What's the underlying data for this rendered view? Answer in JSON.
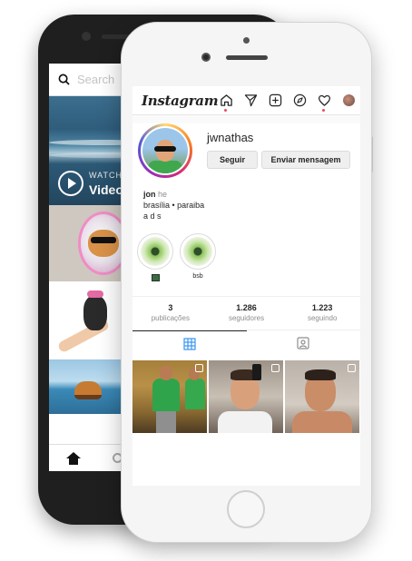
{
  "back_phone": {
    "search_placeholder": "Search",
    "video_tile": {
      "watch_label": "WATCH",
      "video_label": "Video"
    }
  },
  "front_phone": {
    "header": {
      "logo": "Instagram",
      "icons": [
        "home-icon",
        "direct-send-icon",
        "new-post-icon",
        "explore-compass-icon",
        "activity-heart-icon",
        "profile-avatar-icon"
      ]
    },
    "profile": {
      "username": "jwnathas",
      "follow_button": "Seguir",
      "message_button": "Enviar mensagem",
      "bio": {
        "name": "jon",
        "name_extra": "he",
        "line2": "brasília • paraiba",
        "line3": "a d s"
      },
      "highlights": [
        {
          "label": ""
        },
        {
          "label": "bsb"
        }
      ],
      "stats": [
        {
          "value": "3",
          "label": "publicações"
        },
        {
          "value": "1.286",
          "label": "seguidores"
        },
        {
          "value": "1.223",
          "label": "seguindo"
        }
      ],
      "tabs": [
        "grid-icon",
        "tagged-icon"
      ],
      "active_tab": "grid-icon",
      "post_count": 3
    }
  },
  "colors": {
    "notification_dot": "#ed4956",
    "button_bg": "#efefef",
    "text_primary": "#262626",
    "text_secondary": "#8e8e8e"
  }
}
